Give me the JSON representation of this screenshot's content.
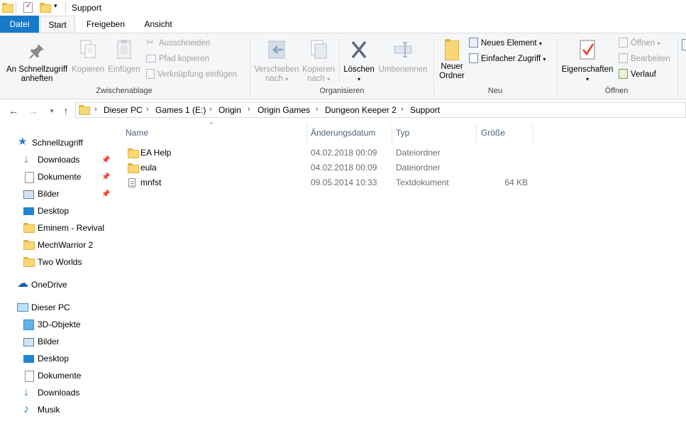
{
  "window": {
    "title": "Support"
  },
  "ribbon_tabs": [
    "Datei",
    "Start",
    "Freigeben",
    "Ansicht"
  ],
  "ribbon": {
    "zwischenablage": {
      "label": "Zwischenablage",
      "pin_quick_access": "An Schnellzugriff anheften",
      "pin_line1": "An Schnellzugriff",
      "pin_line2": "anheften",
      "copy": "Kopieren",
      "paste": "Einfügen",
      "cut": "Ausschneiden",
      "copy_path": "Pfad kopieren",
      "paste_shortcut": "Verknüpfung einfügen"
    },
    "organisieren": {
      "label": "Organisieren",
      "move_to_l1": "Verschieben",
      "move_to_l2": "nach",
      "copy_to_l1": "Kopieren",
      "copy_to_l2": "nach",
      "delete": "Löschen",
      "rename": "Umbenennen"
    },
    "neu": {
      "label": "Neu",
      "new_folder_l1": "Neuer",
      "new_folder_l2": "Ordner",
      "new_item": "Neues Element",
      "easy_access": "Einfacher Zugriff"
    },
    "oeffnen": {
      "label": "Öffnen",
      "properties": "Eigenschaften",
      "open": "Öffnen",
      "edit": "Bearbeiten",
      "history": "Verlauf"
    }
  },
  "breadcrumb": [
    "Dieser PC",
    "Games 1 (E:)",
    "Origin",
    "Origin Games",
    "Dungeon Keeper 2",
    "Support"
  ],
  "nav_pane": {
    "quick_access": "Schnellzugriff",
    "quick_items": [
      "Downloads",
      "Dokumente",
      "Bilder",
      "Desktop",
      "Eminem - Revival",
      "MechWarrior 2",
      "Two Worlds"
    ],
    "onedrive": "OneDrive",
    "this_pc": "Dieser PC",
    "pc_items": [
      "3D-Objekte",
      "Bilder",
      "Desktop",
      "Dokumente",
      "Downloads",
      "Musik"
    ]
  },
  "columns": {
    "name": "Name",
    "modified": "Änderungsdatum",
    "type": "Typ",
    "size": "Größe"
  },
  "files": [
    {
      "name": "EA Help",
      "modified": "04.02.2018 00:09",
      "type": "Dateiordner",
      "size": ""
    },
    {
      "name": "eula",
      "modified": "04.02.2018 00:09",
      "type": "Dateiordner",
      "size": ""
    },
    {
      "name": "mnfst",
      "modified": "09.05.2014 10:33",
      "type": "Textdokument",
      "size": "64 KB"
    }
  ],
  "colors": {
    "accent": "#1979ca",
    "folder": "#f8d775",
    "header_text": "#4c607a"
  }
}
